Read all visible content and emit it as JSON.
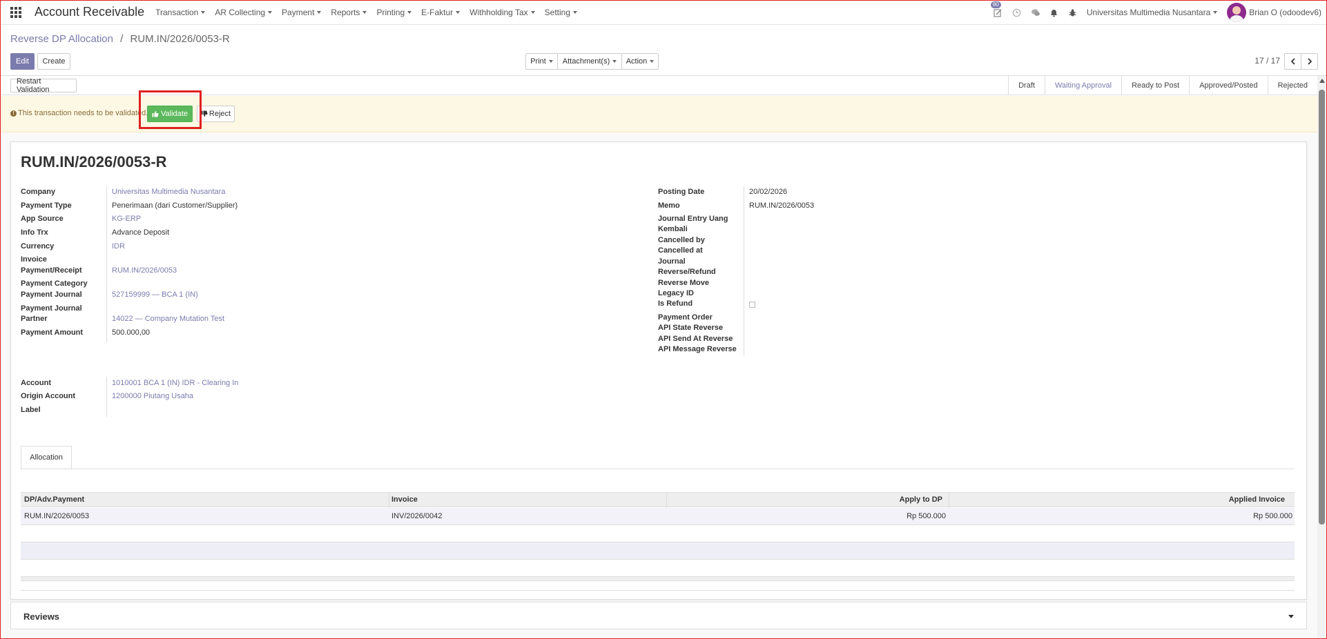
{
  "nav": {
    "app_title": "Account Receivable",
    "menu": [
      "Transaction",
      "AR Collecting",
      "Payment",
      "Reports",
      "Printing",
      "E-Faktur",
      "Withholding Tax",
      "Setting"
    ],
    "badge": "80",
    "company": "Universitas Multimedia Nusantara",
    "user": "Brian O (odoodev6)"
  },
  "breadcrumb": {
    "parent": "Reverse DP Allocation",
    "separator": "/",
    "current": "RUM.IN/2026/0053-R"
  },
  "buttons": {
    "edit": "Edit",
    "create": "Create",
    "print": "Print",
    "attachments": "Attachment(s)",
    "action": "Action",
    "restart_validation": "Restart Validation",
    "validate": "Validate",
    "reject": "Reject"
  },
  "pager": "17 / 17",
  "stages": [
    {
      "label": "Draft",
      "active": false
    },
    {
      "label": "Waiting Approval",
      "active": true
    },
    {
      "label": "Ready to Post",
      "active": false
    },
    {
      "label": "Approved/Posted",
      "active": false
    },
    {
      "label": "Rejected",
      "active": false
    }
  ],
  "alert": {
    "text": "This transaction needs to be validated."
  },
  "record": {
    "title": "RUM.IN/2026/0053-R",
    "left_labels": {
      "company": "Company",
      "payment_type": "Payment Type",
      "app_source": "App Source",
      "info_trx": "Info Trx",
      "currency": "Currency",
      "invoice": "Invoice",
      "payment_receipt": "Payment/Receipt",
      "payment_category": "Payment Category",
      "payment_journal": "Payment Journal",
      "payment_journal_partner_1": "Payment Journal",
      "payment_journal_partner_2": "Partner",
      "payment_amount": "Payment Amount"
    },
    "left_values": {
      "company": "Universitas Multimedia Nusantara",
      "payment_type": "Penerimaan (dari Customer/Supplier)",
      "app_source": "KG-ERP",
      "info_trx": "Advance Deposit",
      "currency": "IDR",
      "payment_receipt": "RUM.IN/2026/0053",
      "payment_journal": "527159999 — BCA 1 (IN)",
      "payment_journal_partner": "14022 — Company Mutation Test",
      "payment_amount": "500.000,00"
    },
    "right_labels": {
      "posting_date": "Posting Date",
      "memo": "Memo",
      "journal_entry_1": "Journal Entry Uang",
      "journal_entry_2": "Kembali",
      "cancelled_by": "Cancelled by",
      "cancelled_at": "Cancelled at",
      "journal": "Journal",
      "reverse_refund": "Reverse/Refund",
      "reverse_move": "Reverse Move",
      "legacy_id": "Legacy ID",
      "is_refund": "Is Refund",
      "payment_order": "Payment Order",
      "api_state_reverse": "API State Reverse",
      "api_send_at_reverse": "API Send At Reverse",
      "api_message_reverse": "API Message Reverse"
    },
    "right_values": {
      "posting_date": "20/02/2026",
      "memo": "RUM.IN/2026/0053",
      "is_refund": false
    },
    "account_labels": {
      "account": "Account",
      "origin_account": "Origin Account",
      "label": "Label"
    },
    "account_values": {
      "account": "1010001 BCA 1 (IN) IDR - Clearing In",
      "origin_account": "1200000 Piutang Usaha"
    }
  },
  "tab": {
    "label": "Allocation"
  },
  "table": {
    "headers": [
      "DP/Adv.Payment",
      "Invoice",
      "Apply to DP",
      "Applied Invoice"
    ],
    "rows": [
      [
        "RUM.IN/2026/0053",
        "INV/2026/0042",
        "Rp 500.000",
        "Rp 500.000"
      ]
    ]
  },
  "reviews": {
    "title": "Reviews"
  }
}
